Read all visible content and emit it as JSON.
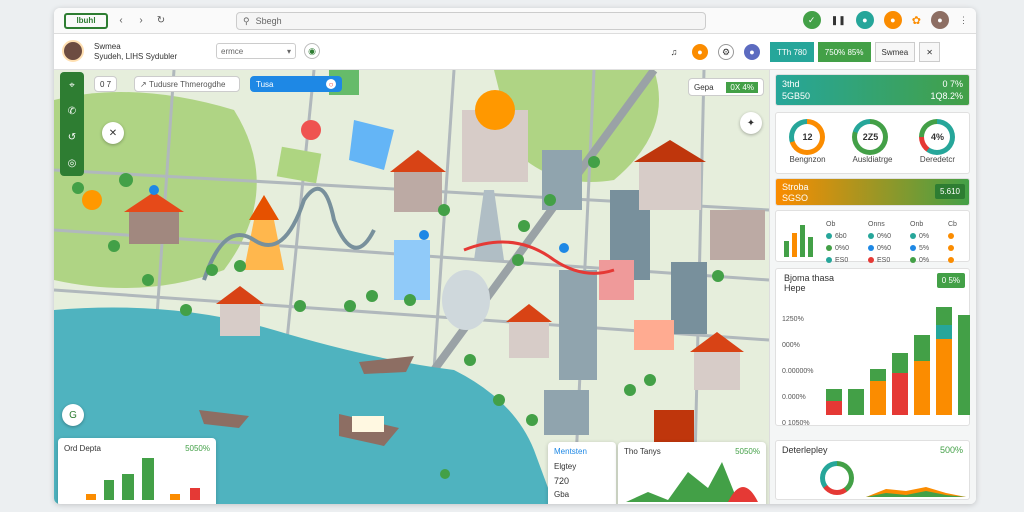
{
  "app": {
    "logo_text": "lbuhl"
  },
  "search": {
    "placeholder": "Sbegh"
  },
  "user": {
    "name_line1": "Swmea",
    "name_line2": "Syudeh, LIHS Sydubler",
    "dropdown_value": "ermce"
  },
  "tabs": [
    {
      "label": "TTh 780"
    },
    {
      "label": "750%  85%"
    },
    {
      "label": "Swmea"
    }
  ],
  "map": {
    "search_pill": "0  7",
    "location_pill": "Tudusre Thmerogdhe",
    "blue_pill": "Tusa",
    "score_pill": {
      "label": "Gepa",
      "value": "0X 4%"
    },
    "bottom_left_card": {
      "title": "Ord Depta",
      "value": "5050%"
    },
    "bottom_card_b": {
      "title": "Mentsten",
      "line1": "Elgtey",
      "line2": "720",
      "line3": "Gba"
    },
    "bottom_card_c": {
      "title": "Tho Tanys",
      "value": "5050%"
    }
  },
  "right": {
    "header1": {
      "left": "3thd",
      "left2": "5GB50",
      "right": "0  7%",
      "right2": "1Q8.2%"
    },
    "donuts": [
      {
        "value": "12",
        "label": "Bengnzon",
        "color": "#fb8c00"
      },
      {
        "value": "2Z5",
        "label": "Ausldiatrge",
        "color": "#43a047"
      },
      {
        "value": "4%",
        "label": "Deredetcr",
        "color": "#26a69a"
      }
    ],
    "header2": {
      "left": "Stroba",
      "left2": "SGSO",
      "badge": "5.610"
    },
    "mini_cols": [
      {
        "title": "Ob",
        "rows": [
          "6b0",
          "0%0",
          "ES0",
          "000"
        ]
      },
      {
        "title": "Onns",
        "rows": [
          "0%0",
          "0%0",
          "ES0",
          "3%"
        ]
      },
      {
        "title": "Onb",
        "rows": [
          "0%",
          "5%",
          "0%",
          "0%"
        ]
      },
      {
        "title": "Cb",
        "rows": [
          "0",
          "0",
          "0",
          "0"
        ]
      }
    ],
    "chart_panel": {
      "title": "Bjoma thasa",
      "subtitle": "Hepe",
      "badge": "0  5%",
      "y_labels": [
        "1250%",
        "000%",
        "0.00000%",
        "0.000%",
        "0 1050%"
      ]
    },
    "bottom_panel": {
      "title": "Deterlepley",
      "value": "500%"
    }
  },
  "colors": {
    "green": "#43a047",
    "teal": "#26a69a",
    "orange": "#fb8c00",
    "red": "#e53935",
    "water": "#4fb3bf"
  }
}
